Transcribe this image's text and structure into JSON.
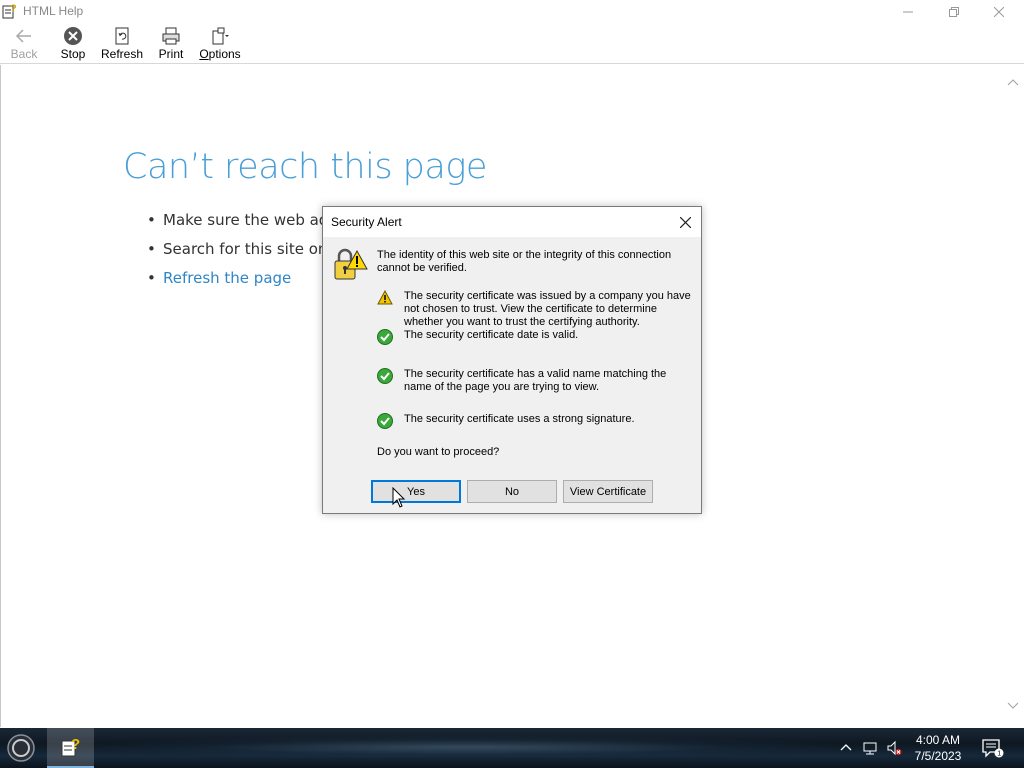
{
  "window": {
    "title": "HTML Help"
  },
  "toolbar": {
    "back_label": "Back",
    "stop_label": "Stop",
    "refresh_label": "Refresh",
    "print_label": "Print",
    "options_label_underlined": "O",
    "options_label_rest": "ptions"
  },
  "page": {
    "error_title": "Can’t reach this page",
    "bullets": [
      "Make sure the web addr",
      "Search for this site on Bi",
      "Refresh the page"
    ]
  },
  "dialog": {
    "title": "Security Alert",
    "intro": "The identity of this web site or the integrity of this connection cannot be verified.",
    "checks": [
      {
        "status": "warning",
        "text": "The security certificate was issued by a company you have not chosen to trust. View the certificate to determine whether you want to trust the certifying authority."
      },
      {
        "status": "ok",
        "text": "The security certificate date is valid."
      },
      {
        "status": "ok",
        "text": "The security certificate has a valid name matching the name of the page you are trying to view."
      },
      {
        "status": "ok",
        "text": "The security certificate uses a strong signature."
      }
    ],
    "question": "Do you want to proceed?",
    "buttons": {
      "yes": "Yes",
      "no": "No",
      "view_certificate": "View Certificate"
    }
  },
  "taskbar": {
    "time": "4:00 AM",
    "date": "7/5/2023",
    "notification_count": "1"
  },
  "colors": {
    "link": "#2f86c7",
    "error_title": "#4a9fd6",
    "ok_green": "#3aa83a",
    "warning_yellow": "#f5c400"
  }
}
